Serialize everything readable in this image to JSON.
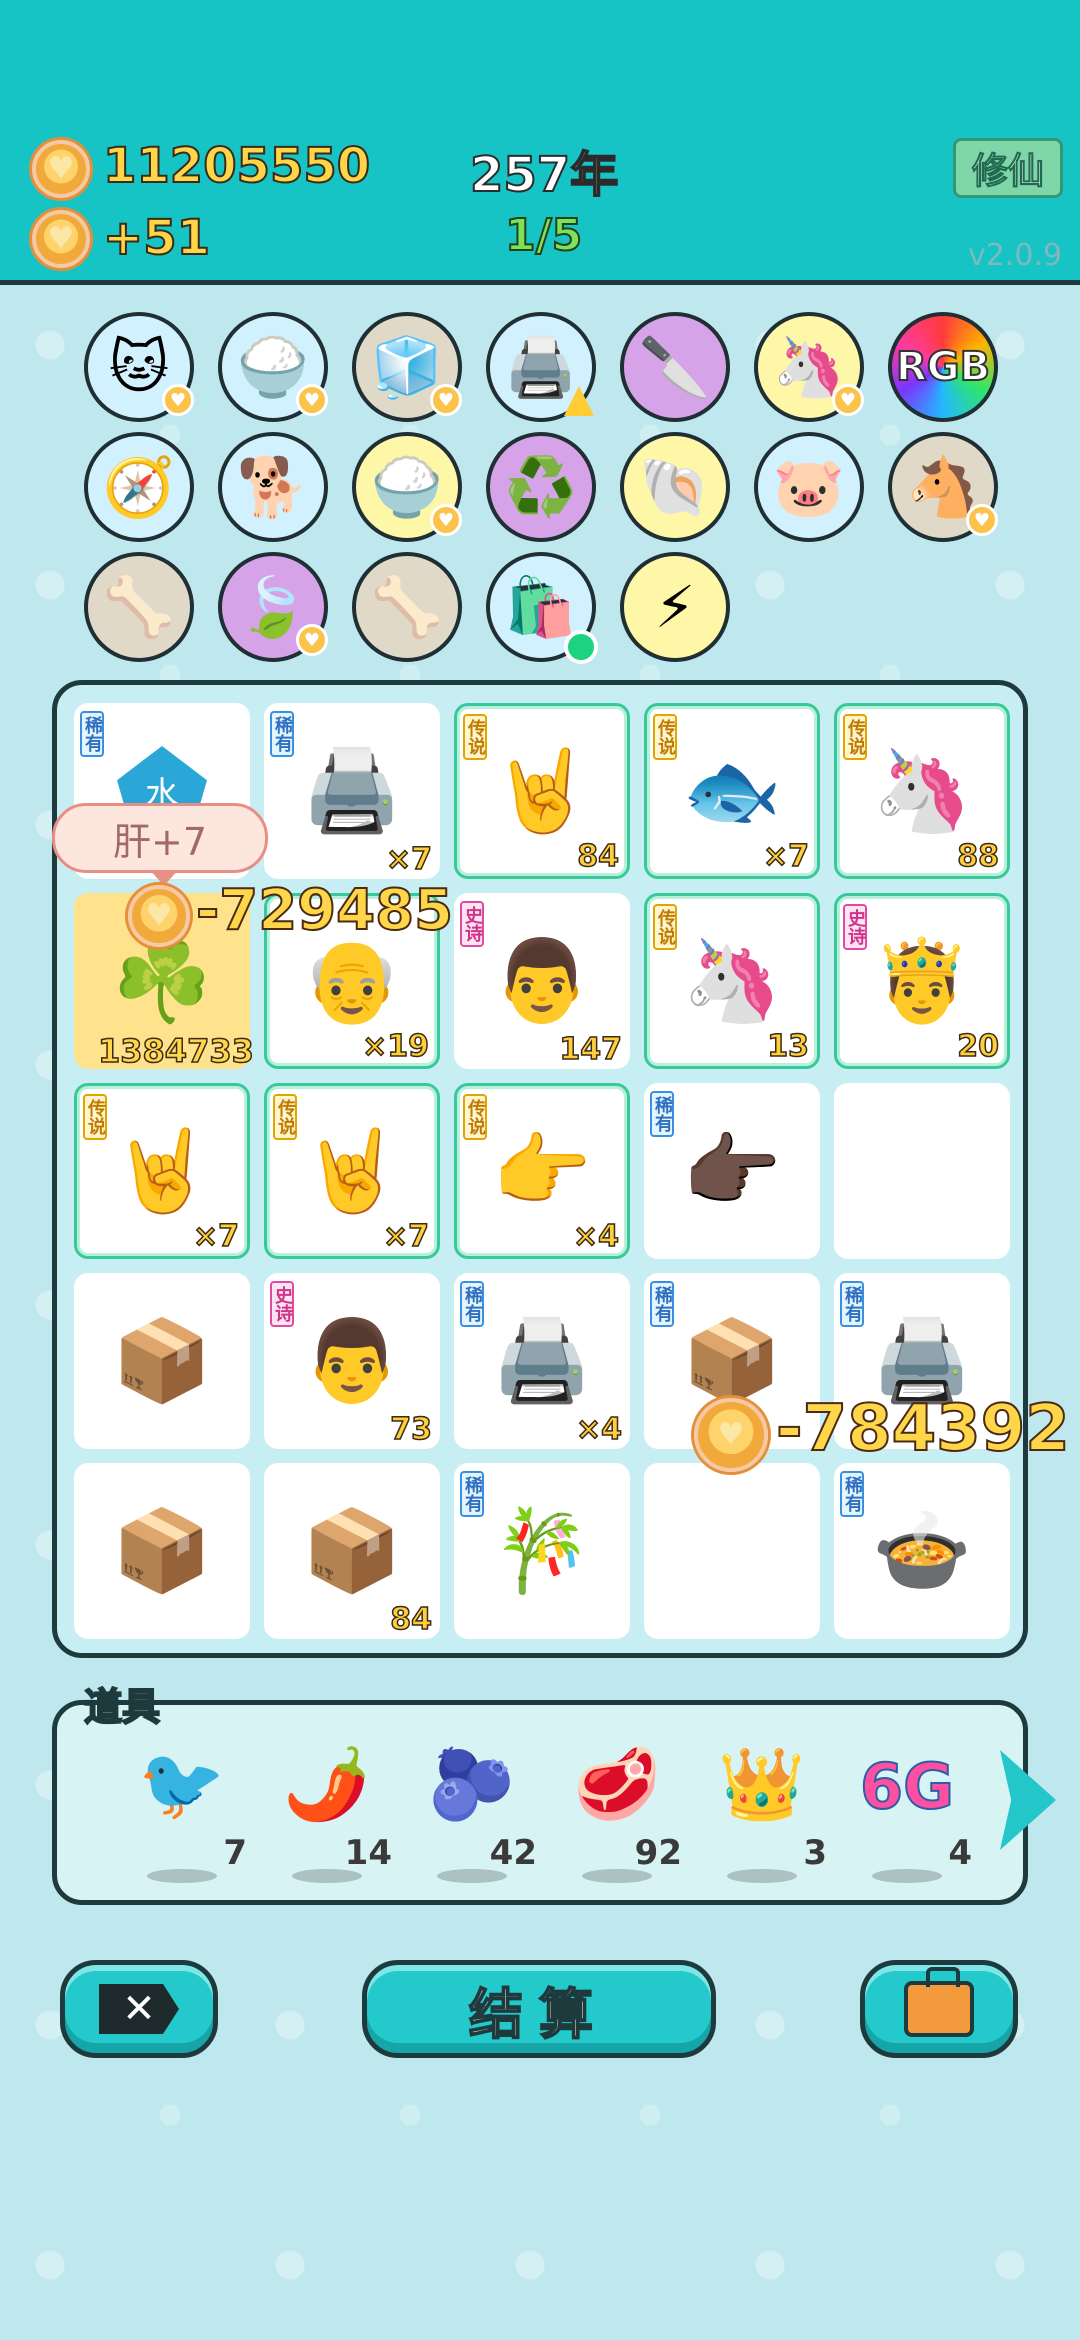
{
  "header": {
    "coins": "11205550",
    "coin_rate": "+51",
    "year": "257年",
    "progress": "1/5",
    "xiuxian_label": "修仙",
    "version": "v2.0.9"
  },
  "floating": {
    "bubble": "肝+7",
    "delta1": "-729485",
    "delta2": "-784392",
    "cell_value": "1384733"
  },
  "grid": {
    "r0c0_label": "水",
    "tags": {
      "rare": "稀有",
      "legend": "传说",
      "epic": "史诗"
    },
    "counts": {
      "r0c1": "×7",
      "r0c2": "84",
      "r0c3": "×7",
      "r0c4": "88",
      "r1c1": "×19",
      "r1c2": "147",
      "r1c3": "13",
      "r1c4": "20",
      "r2c0": "×7",
      "r2c1": "×7",
      "r2c2": "×4",
      "r3c1": "73",
      "r3c2": "×4",
      "r4c1": "84"
    }
  },
  "items": {
    "label": "道具",
    "list": [
      {
        "icon": "bird-icon",
        "qty": "7"
      },
      {
        "icon": "pepper-icon",
        "qty": "14"
      },
      {
        "icon": "blueberry-icon",
        "qty": "42"
      },
      {
        "icon": "liver-icon",
        "qty": "92"
      },
      {
        "icon": "crown-icon",
        "qty": "3"
      },
      {
        "icon": "6g-icon",
        "qty": "4",
        "text": "6G"
      }
    ]
  },
  "buttons": {
    "settle": "结算"
  },
  "circles": {
    "rgb": "RGB"
  }
}
